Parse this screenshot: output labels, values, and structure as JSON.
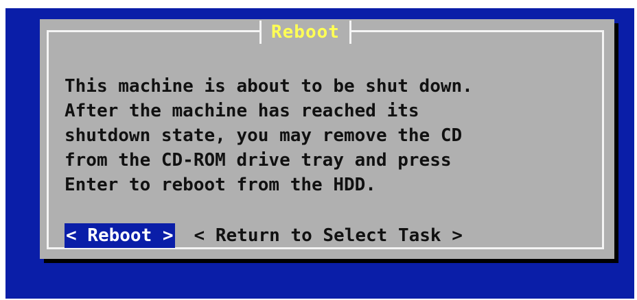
{
  "dialog": {
    "title": "Reboot",
    "message_lines": [
      "This machine is about to be shut down.",
      "After the machine has reached its",
      "shutdown state, you may remove the CD",
      "from the CD-ROM drive tray and press",
      "Enter to reboot from the HDD."
    ],
    "buttons": {
      "reboot": "< Reboot >",
      "return": "< Return to Select Task >"
    },
    "selected_button": "reboot"
  },
  "colors": {
    "screen_background": "#0a1ea8",
    "dialog_background": "#b0b0b0",
    "title_text": "#ffff55",
    "selected_button_bg": "#0a1ea8"
  }
}
